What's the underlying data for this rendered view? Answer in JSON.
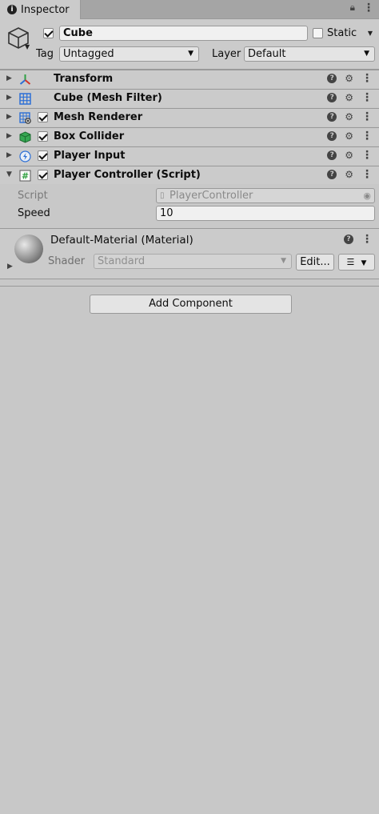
{
  "tab": {
    "title": "Inspector"
  },
  "object": {
    "active": true,
    "name": "Cube",
    "static_label": "Static",
    "static": false,
    "tag_label": "Tag",
    "tag_value": "Untagged",
    "layer_label": "Layer",
    "layer_value": "Default"
  },
  "components": [
    {
      "title": "Transform",
      "icon": "transform-icon",
      "has_checkbox": false
    },
    {
      "title": "Cube (Mesh Filter)",
      "icon": "mesh-filter-icon",
      "has_checkbox": false
    },
    {
      "title": "Mesh Renderer",
      "icon": "mesh-renderer-icon",
      "has_checkbox": true
    },
    {
      "title": "Box Collider",
      "icon": "box-collider-icon",
      "has_checkbox": true
    },
    {
      "title": "Player Input",
      "icon": "player-input-icon",
      "has_checkbox": true
    },
    {
      "title": "Player Controller (Script)",
      "icon": "script-icon",
      "has_checkbox": true,
      "expanded": true
    }
  ],
  "script_props": {
    "script_label": "Script",
    "script_value": "PlayerController",
    "speed_label": "Speed",
    "speed_value": "10"
  },
  "material": {
    "title": "Default-Material (Material)",
    "shader_label": "Shader",
    "shader_value": "Standard",
    "edit_label": "Edit..."
  },
  "add_component": "Add Component",
  "colors": {
    "panel": "#cbcbcb",
    "background": "#c8c8c8",
    "border": "#999999"
  }
}
